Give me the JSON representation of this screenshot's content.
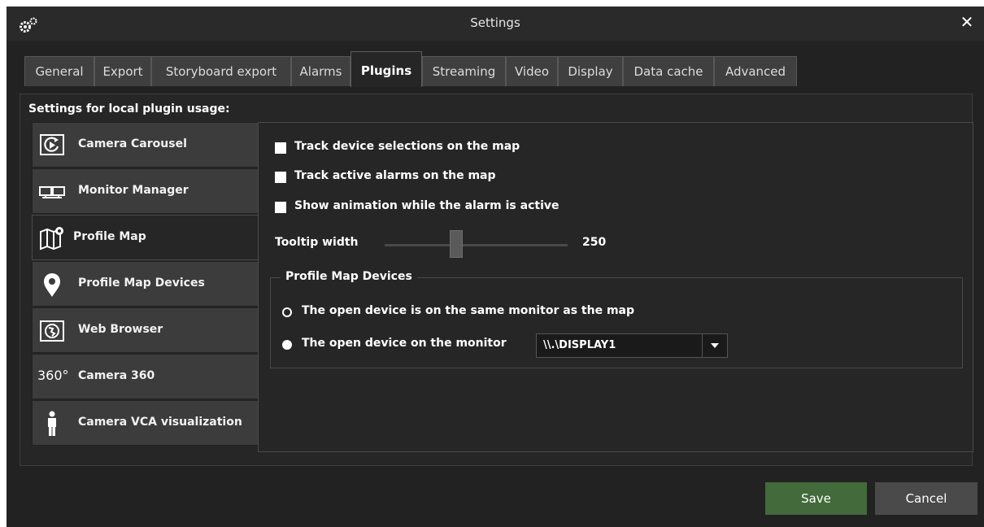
{
  "window": {
    "title": "Settings",
    "app_icon": "gears-icon",
    "close_glyph": "✕"
  },
  "tabs": [
    {
      "label": "General"
    },
    {
      "label": "Export"
    },
    {
      "label": "Storyboard export"
    },
    {
      "label": "Alarms"
    },
    {
      "label": "Plugins",
      "active": true
    },
    {
      "label": "Streaming"
    },
    {
      "label": "Video"
    },
    {
      "label": "Display"
    },
    {
      "label": "Data cache"
    },
    {
      "label": "Advanced"
    }
  ],
  "plugins": {
    "heading": "Settings for local plugin usage:",
    "items": [
      {
        "label": "Camera Carousel",
        "icon": "camera-carousel-icon"
      },
      {
        "label": "Monitor Manager",
        "icon": "monitors-icon"
      },
      {
        "label": "Profile Map",
        "icon": "map-icon",
        "active": true
      },
      {
        "label": "Profile Map Devices",
        "icon": "map-pin-icon"
      },
      {
        "label": "Web Browser",
        "icon": "globe-icon"
      },
      {
        "label": "Camera 360",
        "icon": "camera-360-icon",
        "icon_text": "360°"
      },
      {
        "label": "Camera VCA visualization",
        "icon": "person-icon"
      }
    ]
  },
  "profile_map": {
    "track_selections": {
      "label": "Track device selections on the map",
      "checked": false
    },
    "track_alarms": {
      "label": "Track active alarms on the map",
      "checked": false
    },
    "show_animation": {
      "label": "Show animation while the alarm is active",
      "checked": false
    },
    "tooltip": {
      "label": "Tooltip width",
      "value": "250"
    },
    "devices_group": {
      "title": "Profile Map Devices",
      "option_same": {
        "label": "The open device is on the same monitor as the map",
        "selected": false
      },
      "option_monitor": {
        "label": "The open device on the monitor",
        "selected": true
      },
      "monitor_value": "\\\\.\\DISPLAY1"
    }
  },
  "footer": {
    "save_label": "Save",
    "cancel_label": "Cancel",
    "save_color": "#426a3a"
  }
}
